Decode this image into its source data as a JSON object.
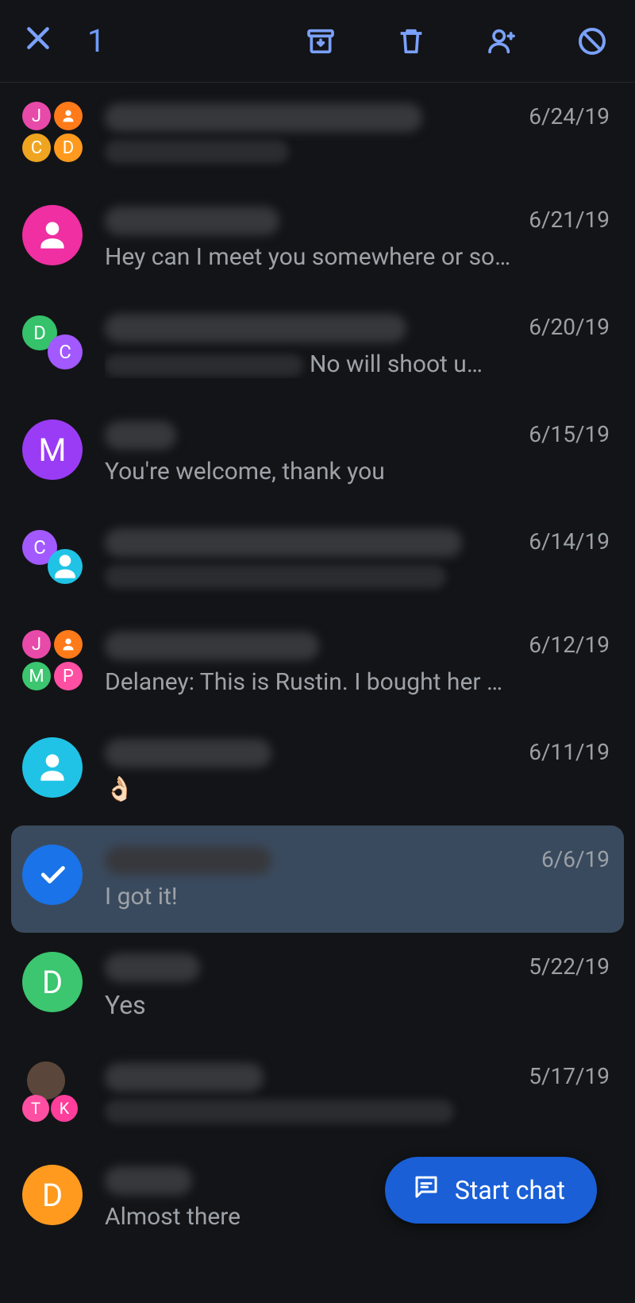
{
  "toolbar": {
    "selected_count": "1"
  },
  "fab": {
    "label": "Start chat"
  },
  "conversations": [
    {
      "date": "6/24/19",
      "title_blur_w": 400,
      "sub_blur_w": 232,
      "preview": "",
      "avatars": {
        "kind": "group4",
        "items": [
          {
            "letter": "J",
            "bg": "#e84aa9"
          },
          {
            "letter": "person",
            "bg": "#ff7a18"
          },
          {
            "letter": "C",
            "bg": "#f0a520"
          },
          {
            "letter": "D",
            "bg": "#ff9a1e"
          }
        ]
      }
    },
    {
      "date": "6/21/19",
      "title_blur_w": 220,
      "preview": "Hey can I meet you somewhere or so…",
      "avatars": {
        "kind": "single",
        "items": [
          {
            "letter": "person",
            "bg": "#ef2fa2"
          }
        ]
      }
    },
    {
      "date": "6/20/19",
      "title_blur_w": 380,
      "prefix_blur_w": 250,
      "preview": "No will shoot u…",
      "avatars": {
        "kind": "pair",
        "items": [
          {
            "letter": "D",
            "bg": "#35c26b"
          },
          {
            "letter": "C",
            "bg": "#a259ff"
          }
        ]
      }
    },
    {
      "date": "6/15/19",
      "title_blur_w": 90,
      "preview": "You're  welcome, thank you",
      "avatars": {
        "kind": "single",
        "items": [
          {
            "letter": "M",
            "bg": "#9a3cf5"
          }
        ]
      }
    },
    {
      "date": "6/14/19",
      "title_blur_w": 450,
      "sub_blur_w": 430,
      "preview": "",
      "avatars": {
        "kind": "pair",
        "items": [
          {
            "letter": "C",
            "bg": "#a259ff"
          },
          {
            "letter": "person",
            "bg": "#20c3e6"
          }
        ]
      }
    },
    {
      "date": "6/12/19",
      "title_blur_w": 270,
      "preview": "Delaney: This is Rustin.  I bought  her …",
      "avatars": {
        "kind": "group4",
        "items": [
          {
            "letter": "J",
            "bg": "#e84aa9"
          },
          {
            "letter": "person",
            "bg": "#ff7a18"
          },
          {
            "letter": "M",
            "bg": "#3bc66f"
          },
          {
            "letter": "P",
            "bg": "#ff4fa3"
          }
        ]
      }
    },
    {
      "date": "6/11/19",
      "title_blur_w": 210,
      "preview": "👌🏻",
      "avatars": {
        "kind": "single",
        "items": [
          {
            "letter": "person",
            "bg": "#20c3e6"
          }
        ]
      }
    },
    {
      "date": "6/6/19",
      "selected": true,
      "title_blur_w": 210,
      "preview": "I got it!",
      "avatars": {
        "kind": "check"
      }
    },
    {
      "date": "5/22/19",
      "title_blur_w": 120,
      "preview": "Yes",
      "avatars": {
        "kind": "single",
        "items": [
          {
            "letter": "D",
            "bg": "#3bc66f"
          }
        ]
      }
    },
    {
      "date": "5/17/19",
      "title_blur_w": 200,
      "sub_blur_w": 440,
      "preview": "",
      "avatars": {
        "kind": "triple",
        "items": [
          {
            "letter": "img",
            "bg": "#5a463a"
          },
          {
            "letter": "T",
            "bg": "#ff4fa3"
          },
          {
            "letter": "K",
            "bg": "#ff3d9a"
          }
        ]
      }
    },
    {
      "date": "",
      "title_blur_w": 110,
      "preview": "Almost there",
      "avatars": {
        "kind": "single",
        "items": [
          {
            "letter": "D",
            "bg": "#ff9a1e"
          }
        ]
      }
    }
  ]
}
